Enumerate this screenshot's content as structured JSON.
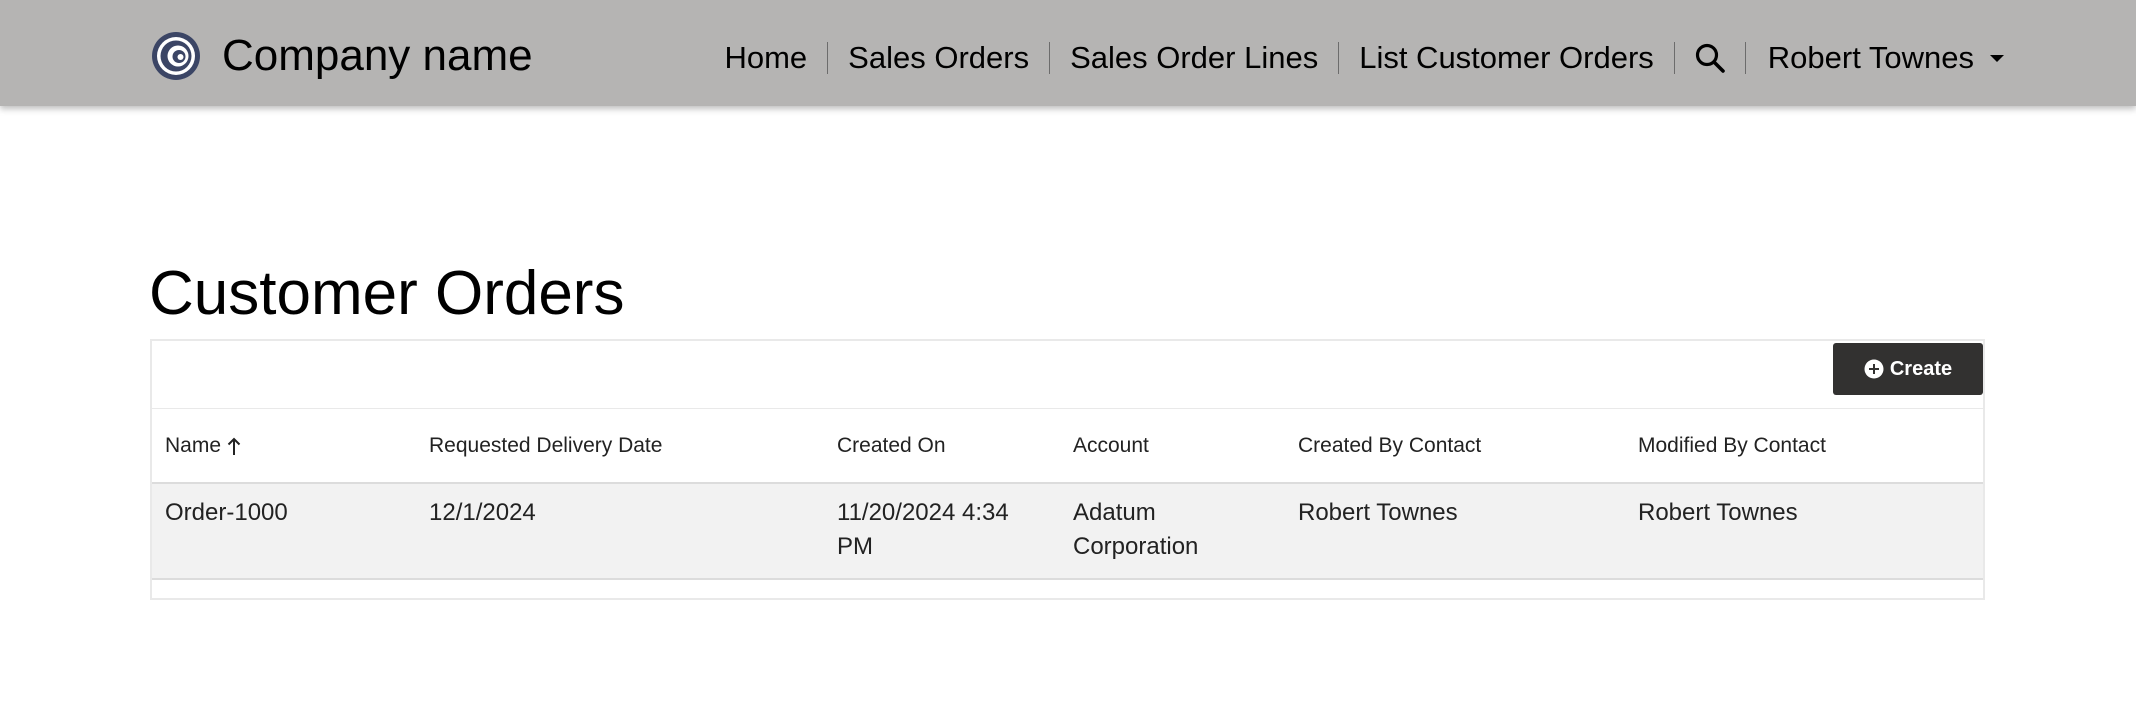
{
  "brand": {
    "name": "Company name",
    "logo_icon": "circle-logo-icon",
    "logo_color": "#3b4565"
  },
  "nav": {
    "items": [
      {
        "label": "Home"
      },
      {
        "label": "Sales Orders"
      },
      {
        "label": "Sales Order Lines"
      },
      {
        "label": "List Customer Orders"
      }
    ],
    "search_icon": "search-icon",
    "user": {
      "name": "Robert Townes",
      "caret_icon": "caret-down-icon"
    },
    "background": "#b5b4b3"
  },
  "page": {
    "title": "Customer Orders"
  },
  "toolbar": {
    "create_label": "Create",
    "create_icon": "plus-circle-icon",
    "button_color": "#323130"
  },
  "grid": {
    "columns": [
      {
        "label": "Name",
        "sort": "ascending",
        "sort_icon": "arrow-up-icon"
      },
      {
        "label": "Requested Delivery Date"
      },
      {
        "label": "Created On"
      },
      {
        "label": "Account"
      },
      {
        "label": "Created By Contact"
      },
      {
        "label": "Modified By Contact"
      }
    ],
    "rows": [
      {
        "name": "Order-1000",
        "requested_delivery_date": "12/1/2024",
        "created_on": "11/20/2024 4:34 PM",
        "account": "Adatum Corporation",
        "created_by_contact": "Robert Townes",
        "modified_by_contact": "Robert Townes"
      }
    ]
  }
}
